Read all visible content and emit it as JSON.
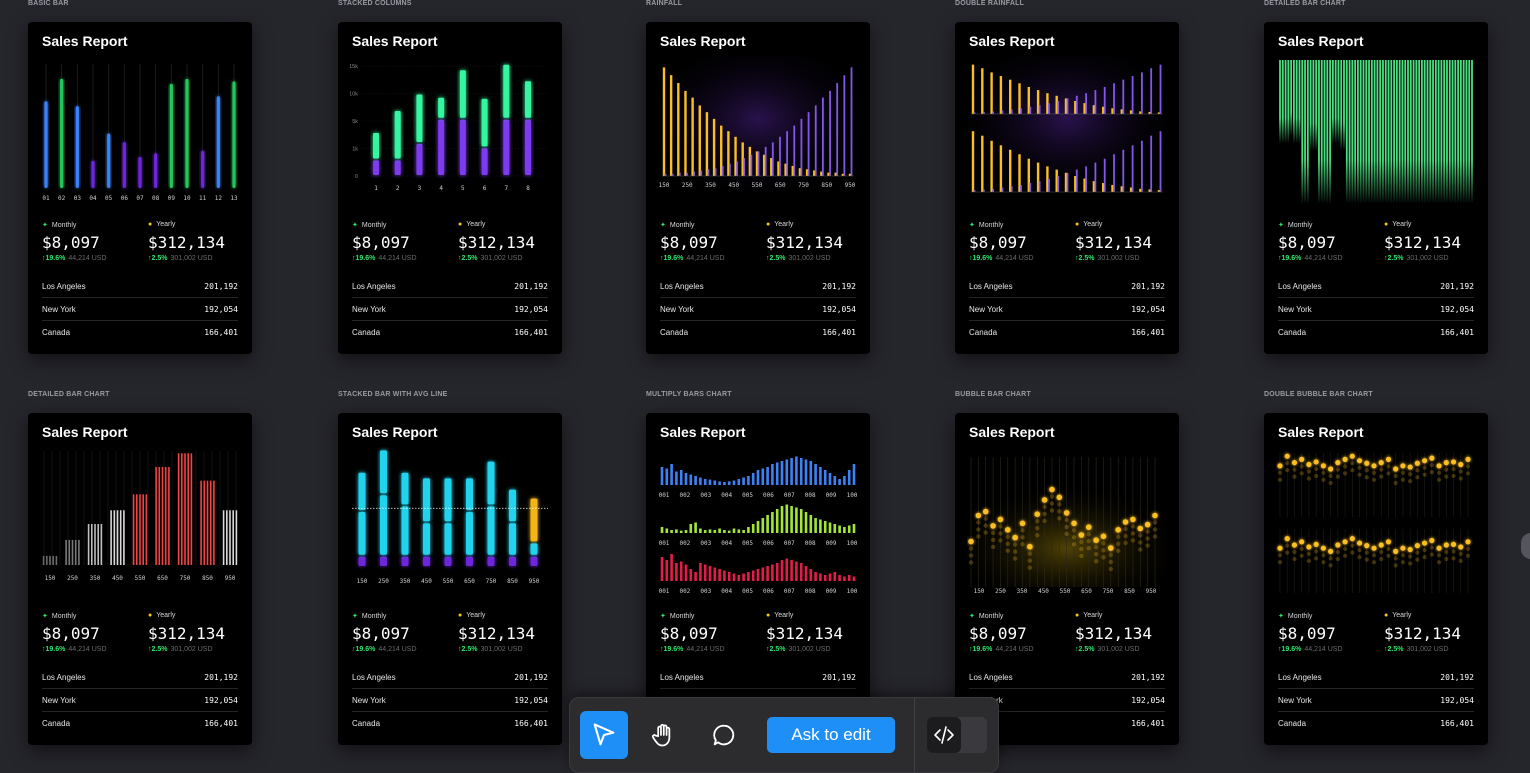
{
  "frames": [
    {
      "label": "Basic bar",
      "chart_kind": "basic"
    },
    {
      "label": "Stacked columns",
      "chart_kind": "stacked"
    },
    {
      "label": "Rainfall",
      "chart_kind": "rainfall"
    },
    {
      "label": "Double rainfall",
      "chart_kind": "double-rainfall"
    },
    {
      "label": "Detailed bar chart",
      "chart_kind": "detailed-green"
    },
    {
      "label": "Detailed bar chart",
      "chart_kind": "detailed-red"
    },
    {
      "label": "Stacked bar with avg line",
      "chart_kind": "stacked-avg"
    },
    {
      "label": "Multiply bars chart",
      "chart_kind": "multiply"
    },
    {
      "label": "Bubble bar chart",
      "chart_kind": "bubble"
    },
    {
      "label": "Double bubble bar chart",
      "chart_kind": "double-bubble"
    }
  ],
  "card": {
    "title": "Sales Report",
    "monthly_label": "Monthly",
    "yearly_label": "Yearly",
    "monthly_value": "$8,097",
    "yearly_value": "$312,134",
    "monthly_change": "↑19.6%",
    "monthly_usd": "44,214 USD",
    "yearly_change": "↑2.5%",
    "yearly_usd": "301,002 USD",
    "rows": [
      {
        "city": "Los Angeles",
        "value": "201,192"
      },
      {
        "city": "New York",
        "value": "192,054"
      },
      {
        "city": "Canada",
        "value": "166,401"
      }
    ]
  },
  "toolbar": {
    "ask_label": "Ask to edit",
    "tools": [
      "cursor-icon",
      "hand-icon",
      "comment-icon"
    ],
    "accent": "#1e8ff7"
  },
  "chart_data": [
    {
      "type": "bar",
      "categories": [
        "01",
        "02",
        "03",
        "04",
        "05",
        "06",
        "07",
        "08",
        "09",
        "10",
        "11",
        "12",
        "13"
      ],
      "values": [
        70,
        88,
        66,
        22,
        44,
        37,
        25,
        28,
        84,
        88,
        30,
        74,
        86
      ],
      "colors": [
        "#3b82f6",
        "#22c55e",
        "#3b82f6",
        "#6d28d9",
        "#3b82f6",
        "#6d28d9",
        "#6d28d9",
        "#6d28d9",
        "#22c55e",
        "#22c55e",
        "#6d28d9",
        "#3b82f6",
        "#22c55e"
      ]
    },
    {
      "type": "bar",
      "categories": [
        "1",
        "2",
        "3",
        "4",
        "5",
        "6",
        "7",
        "8"
      ],
      "y_ticks": [
        "0",
        "1k",
        "5k",
        "10k",
        "15k"
      ],
      "series": [
        {
          "values": [
            15,
            15,
            30,
            52,
            52,
            26,
            52,
            52
          ],
          "color": "#7c3aed"
        },
        {
          "values": [
            25,
            45,
            45,
            20,
            45,
            45,
            50,
            35
          ],
          "color": "#34f5a0"
        }
      ]
    },
    {
      "type": "bar",
      "categories": [
        "150",
        "250",
        "350",
        "450",
        "550",
        "650",
        "750",
        "850",
        "950"
      ],
      "series": [
        {
          "values": [
            97,
            90,
            83,
            76,
            70,
            63,
            57,
            51,
            45,
            40,
            35,
            30,
            26,
            22,
            19,
            16,
            13,
            11,
            9,
            7,
            6,
            5,
            4,
            3,
            3,
            2,
            2
          ],
          "color": "#fbbf24"
        },
        {
          "values": [
            2,
            2,
            3,
            3,
            4,
            5,
            6,
            7,
            9,
            11,
            13,
            16,
            19,
            22,
            26,
            30,
            35,
            40,
            45,
            51,
            57,
            63,
            70,
            76,
            83,
            90,
            97
          ],
          "color": "#8b5cf6"
        }
      ]
    },
    {
      "type": "bar",
      "categories": [],
      "series": [
        {
          "values": [
            95,
            88,
            80,
            73,
            66,
            59,
            52,
            46,
            40,
            35,
            30,
            25,
            21,
            17,
            14,
            11,
            9,
            7,
            5,
            4,
            3
          ],
          "color": "#fbbf24"
        },
        {
          "values": [
            3,
            4,
            5,
            7,
            9,
            11,
            14,
            17,
            21,
            25,
            30,
            35,
            40,
            46,
            52,
            59,
            66,
            73,
            80,
            88,
            95
          ],
          "color": "#8b5cf6"
        }
      ]
    },
    {
      "type": "bar",
      "categories": [],
      "values": [
        55,
        55,
        55,
        55,
        50,
        55,
        55,
        55,
        95,
        95,
        95,
        60,
        60,
        60,
        95,
        95,
        95,
        95,
        95,
        55,
        55,
        55,
        60,
        60,
        95,
        95,
        95,
        95,
        95,
        95,
        95,
        95,
        95,
        95,
        95,
        95,
        95,
        95,
        95,
        95,
        95,
        95,
        95,
        95,
        95,
        95,
        95,
        95,
        95,
        95,
        95,
        95,
        95,
        95,
        95,
        95,
        95,
        95,
        95,
        95,
        95,
        95,
        95,
        95,
        95,
        95,
        95,
        95,
        95,
        95
      ],
      "color": "#4ade80"
    },
    {
      "type": "bar",
      "categories": [
        "150",
        "250",
        "350",
        "450",
        "550",
        "650",
        "750",
        "850",
        "950"
      ],
      "values": [
        8,
        22,
        36,
        48,
        62,
        86,
        98,
        74,
        48
      ],
      "colors": [
        "#6b6b6b",
        "#7a7a7a",
        "#bfbfbf",
        "#d9d9d9",
        "#ef4444",
        "#ef4444",
        "#ef4444",
        "#ef4444",
        "#d9d9d9"
      ]
    },
    {
      "type": "bar",
      "categories": [
        "150",
        "250",
        "350",
        "450",
        "550",
        "650",
        "750",
        "850",
        "950"
      ],
      "avg_line": 48,
      "series": [
        {
          "values": [
            10,
            10,
            10,
            10,
            10,
            10,
            10,
            10,
            10
          ],
          "color": "#6d28d9"
        },
        {
          "values": [
            40,
            55,
            45,
            30,
            30,
            40,
            45,
            30,
            12
          ],
          "color": "#22d3ee"
        },
        {
          "values": [
            35,
            40,
            30,
            40,
            40,
            30,
            40,
            30,
            40
          ],
          "color": "#22d3ee"
        }
      ]
    },
    {
      "type": "bar",
      "categories": [
        "001",
        "002",
        "003",
        "004",
        "005",
        "006",
        "007",
        "008",
        "009",
        "100"
      ],
      "series": [
        {
          "values": [
            60,
            55,
            70,
            45,
            50,
            40,
            35,
            30,
            25,
            20,
            18,
            15,
            12,
            10,
            12,
            15,
            20,
            25,
            30,
            40,
            50,
            55,
            60,
            70,
            75,
            80,
            85,
            90,
            95,
            90,
            85,
            80,
            70,
            60,
            50,
            40,
            30,
            20,
            30,
            50,
            70
          ],
          "color": "#3b82f6"
        },
        {
          "values": [
            20,
            15,
            10,
            12,
            8,
            10,
            30,
            35,
            15,
            10,
            12,
            10,
            15,
            10,
            8,
            15,
            12,
            10,
            20,
            30,
            40,
            50,
            60,
            70,
            80,
            90,
            95,
            90,
            85,
            80,
            70,
            60,
            50,
            45,
            40,
            35,
            30,
            25,
            20,
            25,
            30
          ],
          "color": "#a3e635"
        },
        {
          "values": [
            80,
            70,
            90,
            60,
            65,
            55,
            40,
            30,
            60,
            55,
            50,
            45,
            40,
            35,
            30,
            25,
            20,
            25,
            30,
            35,
            40,
            45,
            50,
            55,
            60,
            70,
            75,
            70,
            65,
            60,
            50,
            40,
            30,
            25,
            20,
            25,
            30,
            20,
            15,
            20,
            15
          ],
          "color": "#e11d48"
        }
      ]
    },
    {
      "type": "scatter",
      "categories": [
        "150",
        "250",
        "350",
        "450",
        "550",
        "650",
        "750",
        "850",
        "950"
      ],
      "points": [
        35,
        55,
        58,
        47,
        52,
        44,
        38,
        49,
        31,
        56,
        67,
        75,
        69,
        57,
        49,
        40,
        46,
        36,
        39,
        30,
        44,
        50,
        52,
        45,
        48,
        55
      ],
      "color": "#fbbf24"
    },
    {
      "type": "scatter",
      "categories": [],
      "series": [
        {
          "points": [
            80,
            95,
            85,
            90,
            82,
            86,
            80,
            75,
            85,
            90,
            95,
            88,
            84,
            80,
            85,
            90,
            75,
            80,
            78,
            84,
            88,
            92,
            80,
            85,
            86,
            82,
            90
          ],
          "color": "#fbbf24"
        },
        {
          "points": [
            70,
            85,
            75,
            80,
            72,
            76,
            70,
            65,
            75,
            80,
            85,
            78,
            74,
            70,
            75,
            80,
            65,
            70,
            68,
            74,
            78,
            82,
            70,
            75,
            76,
            72,
            80
          ],
          "color": "#fbbf24"
        }
      ]
    }
  ]
}
